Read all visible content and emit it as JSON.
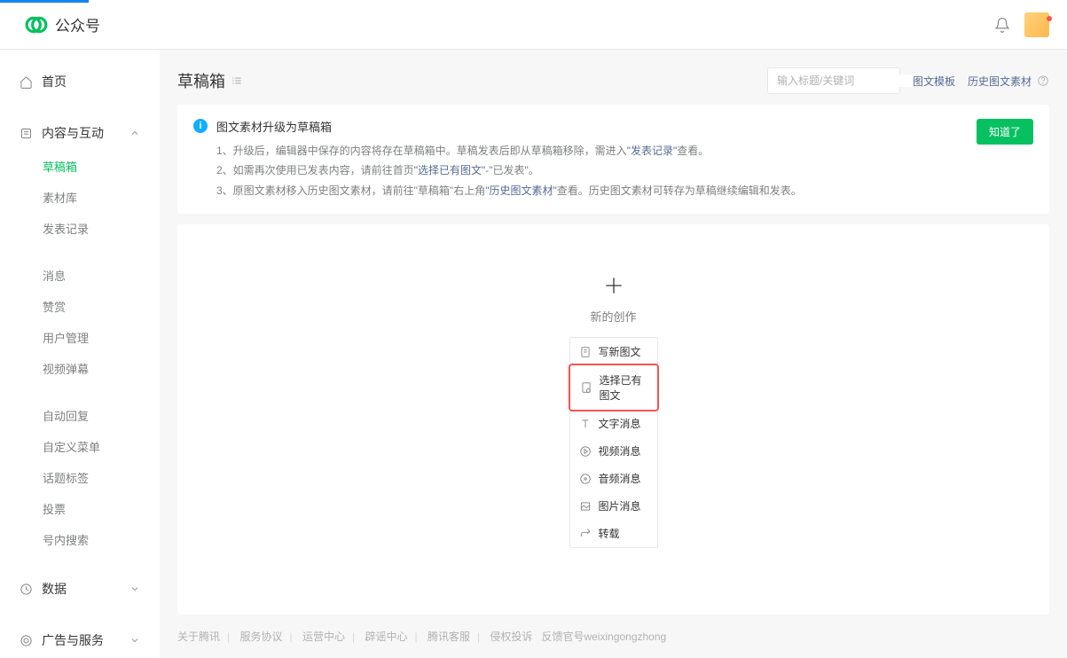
{
  "header": {
    "brand": "公众号"
  },
  "sidebar": {
    "home": "首页",
    "content_interact": "内容与互动",
    "subs1": [
      "草稿箱",
      "素材库",
      "发表记录"
    ],
    "subs2": [
      "消息",
      "赞赏",
      "用户管理",
      "视频弹幕"
    ],
    "subs3": [
      "自动回复",
      "自定义菜单",
      "话题标签",
      "投票",
      "号内搜索"
    ],
    "data": "数据",
    "ads": "广告与服务"
  },
  "page": {
    "title": "草稿箱",
    "search_placeholder": "输入标题/关键词",
    "link1": "图文模板",
    "link2": "历史图文素材"
  },
  "notice": {
    "title": "图文素材升级为草稿箱",
    "l1a": "1、升级后，编辑器中保存的内容将存在草稿箱中。草稿发表后即从草稿箱移除，需进入",
    "l1b": "\"发表记录\"",
    "l1c": "查看。",
    "l2a": "2、如需再次使用已发表内容，请前往首页",
    "l2b": "\"选择已有图文\"",
    "l2c": "-\"已发表\"。",
    "l3a": "3、原图文素材移入历史图文素材，请前往\"草稿箱\"右上角",
    "l3b": "\"历史图文素材\"",
    "l3c": "查看。历史图文素材可转存为草稿继续编辑和发表。",
    "btn": "知道了"
  },
  "create": {
    "title": "新的创作",
    "items": [
      "写新图文",
      "选择已有图文",
      "文字消息",
      "视频消息",
      "音频消息",
      "图片消息",
      "转载"
    ]
  },
  "footer": {
    "items": [
      "关于腾讯",
      "服务协议",
      "运营中心",
      "辟谣中心",
      "腾讯客服",
      "侵权投诉"
    ],
    "tail": "反馈官号weixingongzhong"
  }
}
